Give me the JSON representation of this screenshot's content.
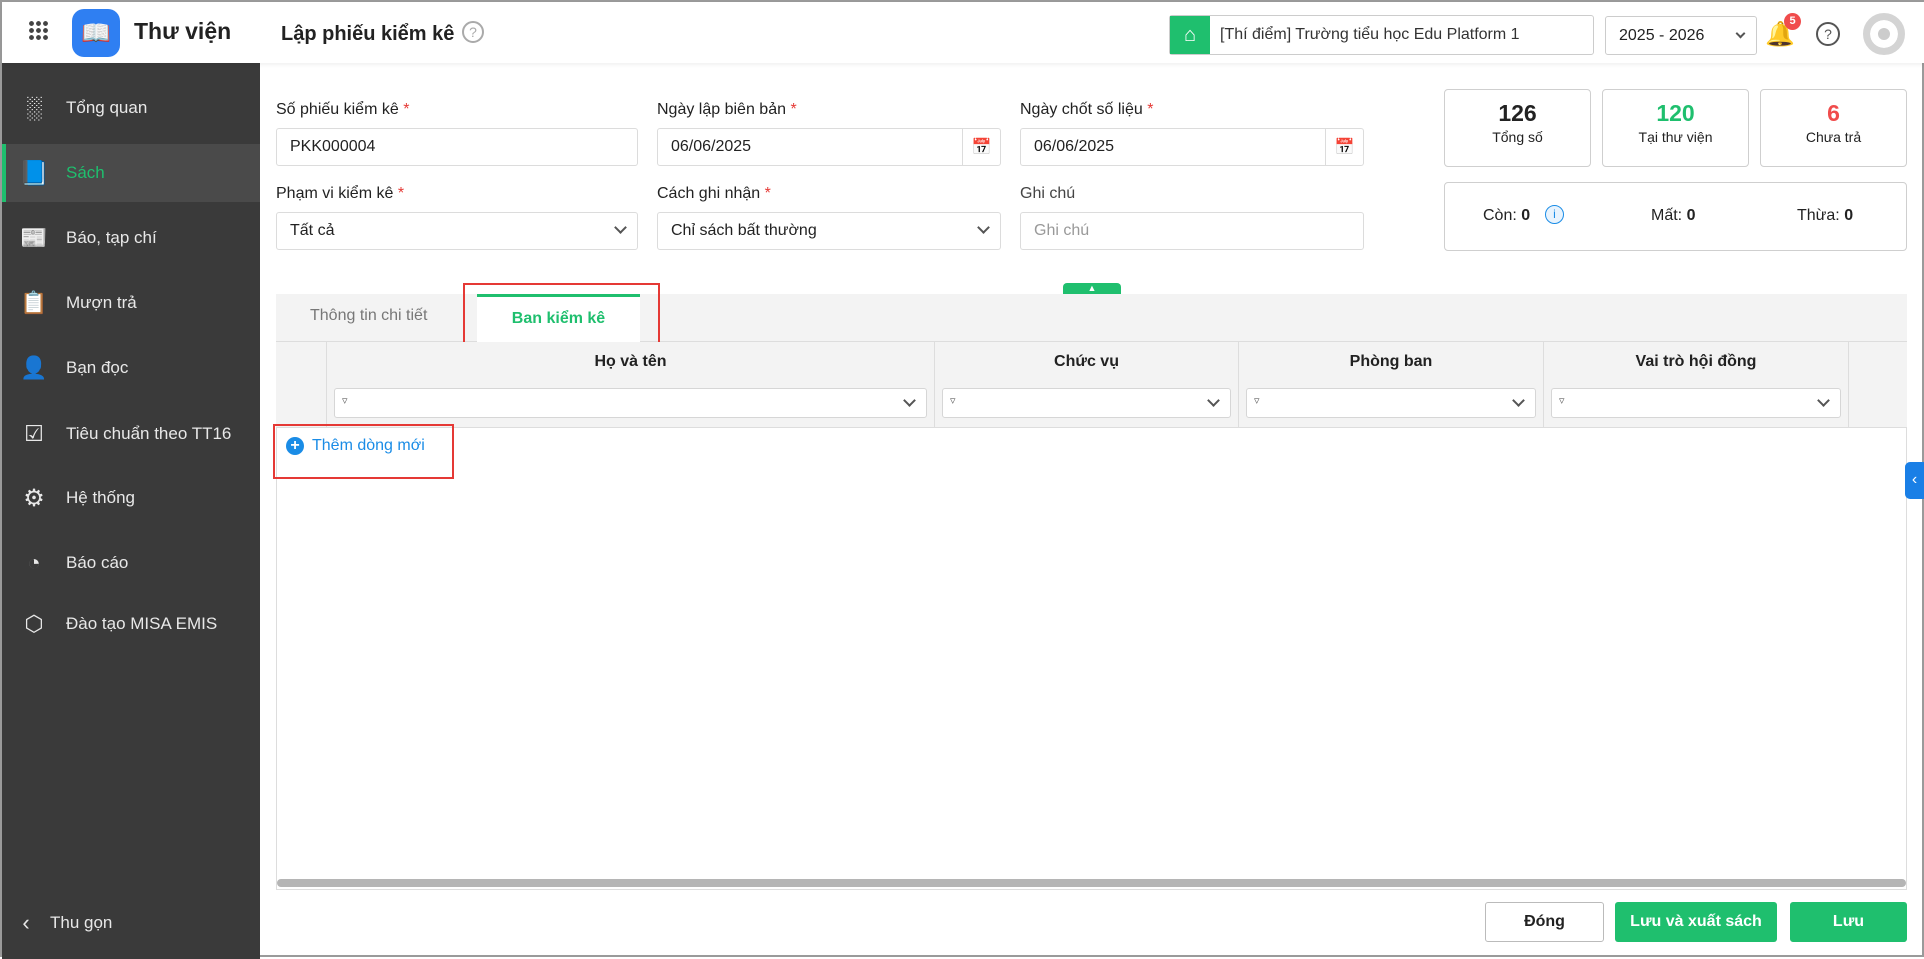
{
  "app": {
    "name": "Thư viện",
    "page_title": "Lập phiếu kiểm kê"
  },
  "header": {
    "school": "[Thí điểm] Trường tiểu học Edu Platform 1",
    "year": "2025 - 2026",
    "notifications": "5"
  },
  "sidebar": {
    "items": [
      {
        "label": "Tổng quan",
        "icon": "chart-bars-icon"
      },
      {
        "label": "Sách",
        "icon": "book-icon"
      },
      {
        "label": "Báo, tạp chí",
        "icon": "newspaper-icon"
      },
      {
        "label": "Mượn trả",
        "icon": "borrow-icon"
      },
      {
        "label": "Bạn đọc",
        "icon": "reader-icon"
      },
      {
        "label": "Tiêu chuẩn theo TT16",
        "icon": "checklist-icon"
      },
      {
        "label": "Hệ thống",
        "icon": "gear-icon"
      },
      {
        "label": "Báo cáo",
        "icon": "pie-chart-icon"
      },
      {
        "label": "Đào tạo MISA EMIS",
        "icon": "box-icon"
      }
    ],
    "collapse": "Thu gọn"
  },
  "form": {
    "so_phieu": {
      "label": "Số phiếu kiểm kê",
      "value": "PKK000004"
    },
    "ngay_lap": {
      "label": "Ngày lập biên bản",
      "value": "06/06/2025"
    },
    "ngay_chot": {
      "label": "Ngày chốt số liệu",
      "value": "06/06/2025"
    },
    "pham_vi": {
      "label": "Phạm vi kiểm kê",
      "value": "Tất cả"
    },
    "cach_ghi": {
      "label": "Cách ghi nhận",
      "value": "Chỉ sách bất thường"
    },
    "ghi_chu": {
      "label": "Ghi chú",
      "placeholder": "Ghi chú"
    },
    "required_mark": "*"
  },
  "stats": {
    "total": {
      "value": "126",
      "label": "Tổng số"
    },
    "in_library": {
      "value": "120",
      "label": "Tại thư viện"
    },
    "not_returned": {
      "value": "6",
      "label": "Chưa trả"
    },
    "con": {
      "label": "Còn:",
      "value": "0"
    },
    "mat": {
      "label": "Mất:",
      "value": "0"
    },
    "thua": {
      "label": "Thừa:",
      "value": "0"
    }
  },
  "tabs": [
    {
      "label": "Thông tin chi tiết"
    },
    {
      "label": "Ban kiểm kê",
      "active": true
    }
  ],
  "grid": {
    "columns": [
      "Họ và tên",
      "Chức vụ",
      "Phòng ban",
      "Vai trò hội đồng"
    ],
    "add_row": "Thêm dòng mới"
  },
  "footer": {
    "close": "Đóng",
    "save_export": "Lưu và xuất sách",
    "save": "Lưu"
  },
  "colors": {
    "accent": "#1fbf6e",
    "danger": "#e53935",
    "link": "#1a8ce6"
  }
}
